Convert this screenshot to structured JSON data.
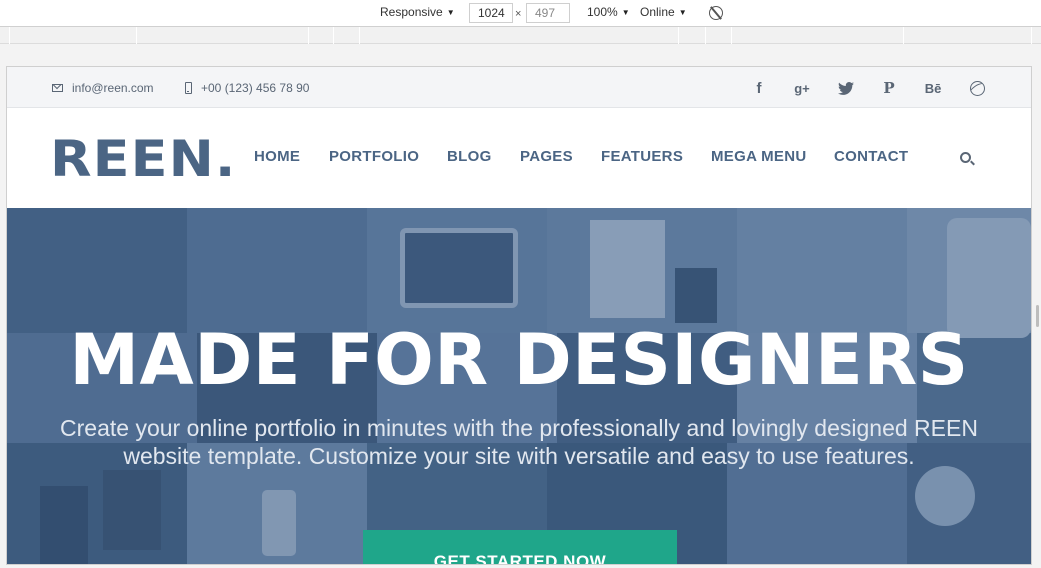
{
  "devtools": {
    "device": "Responsive",
    "width": "1024",
    "height": "497",
    "times": "×",
    "zoom": "100%",
    "network": "Online",
    "icons": {
      "caret": "chevron-down-icon",
      "rotate": "rotate-icon"
    }
  },
  "topbar": {
    "email": "info@reen.com",
    "phone": "+00 (123) 456 78 90",
    "social": [
      {
        "name": "facebook",
        "glyph": "f"
      },
      {
        "name": "google-plus",
        "glyph": "g+"
      },
      {
        "name": "twitter",
        "glyph": "🐦"
      },
      {
        "name": "pinterest",
        "glyph": "P"
      },
      {
        "name": "behance",
        "glyph": "Bē"
      },
      {
        "name": "dribbble",
        "glyph": ""
      }
    ]
  },
  "header": {
    "logo": "REEN.",
    "nav": [
      "HOME",
      "PORTFOLIO",
      "BLOG",
      "PAGES",
      "FEATUERS",
      "MEGA MENU",
      "CONTACT"
    ]
  },
  "hero": {
    "title": "MADE FOR DESIGNERS",
    "subtitle": "Create your online portfolio in minutes with the professionally and lovingly designed REEN website template. Customize your site with versatile and easy to use features.",
    "cta": "GET STARTED NOW"
  },
  "colors": {
    "brand": "#4b6584",
    "cta": "#1fa68a",
    "hero_tint": "#4d6a8d"
  }
}
